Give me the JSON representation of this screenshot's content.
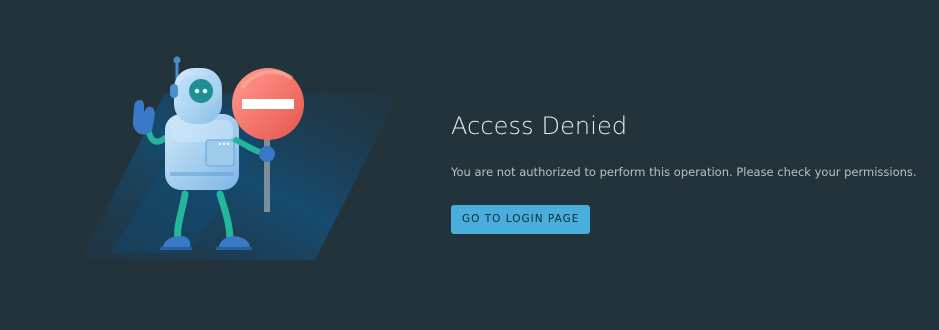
{
  "error": {
    "title": "Access Denied",
    "message": "You are not authorized to perform this operation. Please check your permissions.",
    "action_label": "GO TO LOGIN PAGE"
  },
  "illustration": {
    "subject": "robot-holding-stop-sign",
    "accent_color": "#49aedb",
    "stop_sign_color": "#f0706c",
    "background_color": "#22333c"
  }
}
